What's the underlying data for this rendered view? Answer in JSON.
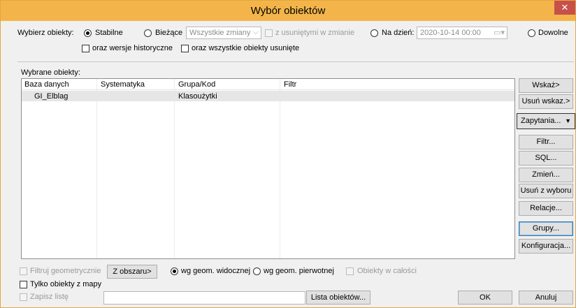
{
  "window": {
    "title": "Wybór obiektów",
    "close_glyph": "✕"
  },
  "select": {
    "label": "Wybierz obiekty:",
    "stabilne": "Stabilne",
    "biezace": "Bieżące",
    "changes_value": "Wszystkie zmiany",
    "with_deleted_in_change": "z usuniętymi w zmianie",
    "na_dzien": "Na dzień:",
    "date_value": "2020-10-14 00:00",
    "dowolne": "Dowolne",
    "historical": "oraz wersje historyczne",
    "deleted_all": "oraz wszystkie obiekty usunięte",
    "selected_mode": "stabilne"
  },
  "selected": {
    "label": "Wybrane obiekty:",
    "columns": [
      "Baza danych",
      "Systematyka",
      "Grupa/Kod",
      "Filtr"
    ],
    "rows": [
      {
        "baza": "GI_Elblag",
        "systematyka": "",
        "grupa": "Klasoużytki",
        "filtr": ""
      }
    ]
  },
  "side_buttons": {
    "wskaz": "Wskaż>",
    "usun_wskaz": "Usuń wskaz.>",
    "zapytania": "Zapytania...",
    "filtr": "Filtr...",
    "sql": "SQL...",
    "zmien": "Zmień...",
    "usun_z_wyboru": "Usuń z wyboru",
    "relacje": "Relacje...",
    "grupy": "Grupy...",
    "konfiguracja": "Konfiguracja..."
  },
  "bottom": {
    "filter_geom": "Filtruj geometrycznie",
    "z_obszaru": "Z obszaru>",
    "wg_widocznej": "wg geom. widocznej",
    "wg_pierwotnej": "wg geom. pierwotnej",
    "w_calosci": "Obiekty w całości",
    "tylko_z_mapy": "Tylko obiekty z mapy",
    "zapisz_liste": "Zapisz listę",
    "lista_obiektow": "Lista obiektów...",
    "ok": "OK",
    "anuluj": "Anuluj"
  }
}
